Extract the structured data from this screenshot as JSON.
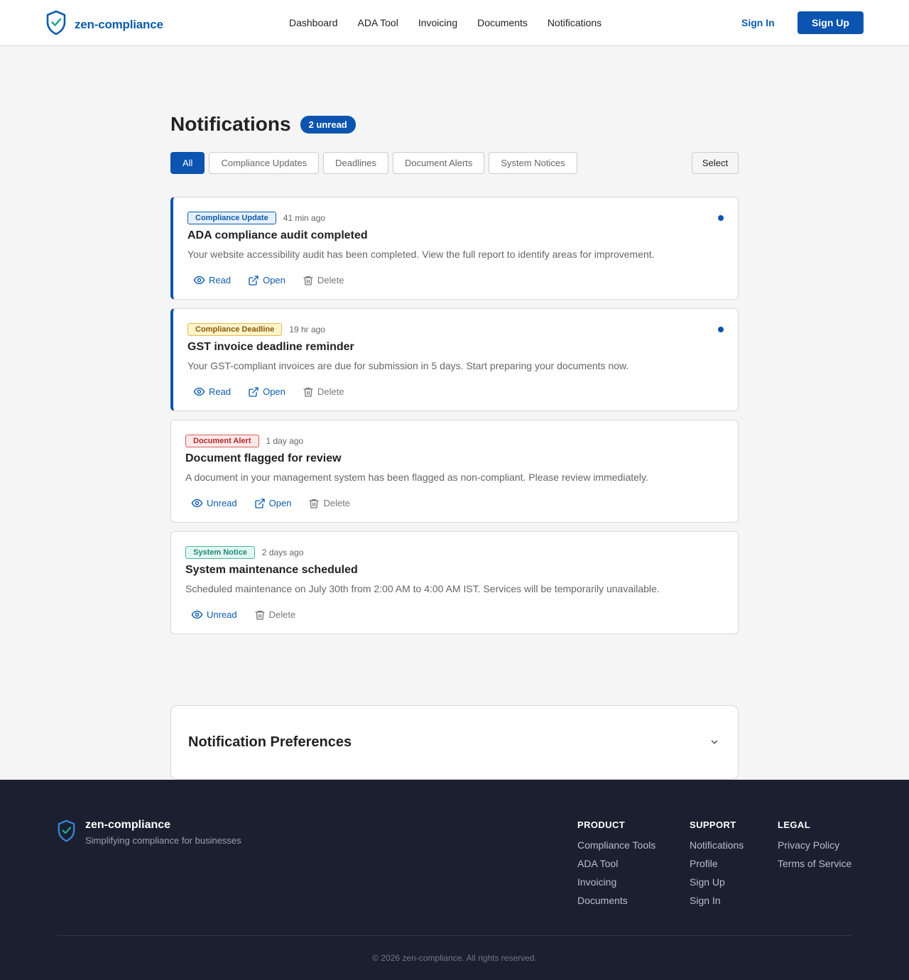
{
  "header": {
    "brand": "zen-compliance",
    "nav": [
      "Dashboard",
      "ADA Tool",
      "Invoicing",
      "Documents",
      "Notifications"
    ],
    "sign_in": "Sign In",
    "sign_up": "Sign Up"
  },
  "main": {
    "title": "Notifications",
    "unread_badge": "2 unread",
    "filters": [
      "All",
      "Compliance Updates",
      "Deadlines",
      "Document Alerts",
      "System Notices"
    ],
    "active_filter": "All",
    "select_label": "Select"
  },
  "notifications": [
    {
      "tag": "Compliance Update",
      "tag_color": "#0b5cad",
      "time": "41 min ago",
      "title": "ADA compliance audit completed",
      "body": "Your website accessibility audit has been completed. View the full report to identify areas for improvement.",
      "unread": true,
      "read_toggle": "Read",
      "open": "Open",
      "delete": "Delete"
    },
    {
      "tag": "Compliance Deadline",
      "tag_color": "#e8b84a",
      "time": "19 hr ago",
      "title": "GST invoice deadline reminder",
      "body": "Your GST-compliant invoices are due for submission in 5 days. Start preparing your documents now.",
      "unread": true,
      "read_toggle": "Read",
      "open": "Open",
      "delete": "Delete"
    },
    {
      "tag": "Document Alert",
      "tag_color": "#d65c5c",
      "time": "1 day ago",
      "title": "Document flagged for review",
      "body": "A document in your management system has been flagged as non-compliant. Please review immediately.",
      "unread": false,
      "read_toggle": "Unread",
      "open": "Open",
      "delete": "Delete"
    },
    {
      "tag": "System Notice",
      "tag_color": "#49b7a3",
      "time": "2 days ago",
      "title": "System maintenance scheduled",
      "body": "Scheduled maintenance on July 30th from 2:00 AM to 4:00 AM IST. Services will be temporarily unavailable.",
      "unread": false,
      "read_toggle": "Unread",
      "delete": "Delete"
    }
  ],
  "preferences": {
    "title": "Notification Preferences"
  },
  "footer": {
    "brand": "zen-compliance",
    "tagline": "Simplifying compliance for businesses",
    "columns": [
      {
        "heading": "PRODUCT",
        "links": [
          "Compliance Tools",
          "ADA Tool",
          "Invoicing",
          "Documents"
        ]
      },
      {
        "heading": "SUPPORT",
        "links": [
          "Notifications",
          "Profile",
          "Sign Up",
          "Sign In"
        ]
      },
      {
        "heading": "LEGAL",
        "links": [
          "Privacy Policy",
          "Terms of Service"
        ]
      }
    ],
    "copyright": "© 2026 zen-compliance. All rights reserved."
  },
  "colors": {
    "primary": "#0b54b0",
    "footer_bg": "#1a2030"
  }
}
